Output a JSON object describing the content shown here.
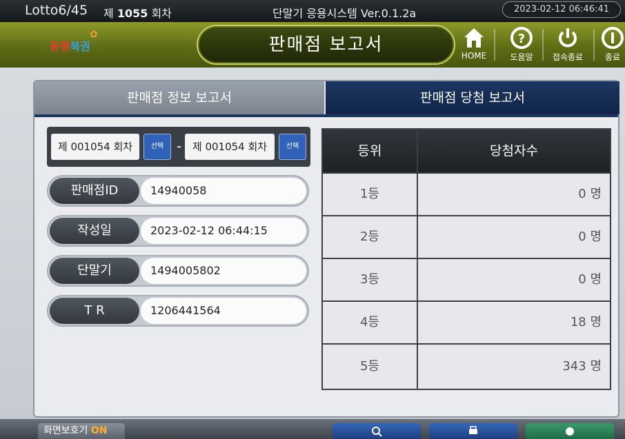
{
  "topbar": {
    "game": "Lotto6/45",
    "round_prefix": "제",
    "round_number": "1055",
    "round_suffix": "회차",
    "system": "단말기 응용시스템  Ver.0.1.2a",
    "datetime": "2023-02-12  06:46:41"
  },
  "header": {
    "logo_part1": "동행",
    "logo_part2": "복권",
    "title": "판매점 보고서",
    "buttons": {
      "home": "HOME",
      "help": "도움말",
      "logout": "접속종료",
      "exit": "종료"
    }
  },
  "tabs": {
    "info": "판매점 정보 보고서",
    "win": "판매점 당첨 보고서"
  },
  "round_range": {
    "from": "제 001054 회차",
    "to": "제 001054 회차",
    "select_label": "선택",
    "dash": "-"
  },
  "info_rows": [
    {
      "label": "판매점ID",
      "value": "14940058"
    },
    {
      "label": "작성일",
      "value": "2023-02-12  06:44:15"
    },
    {
      "label": "단말기",
      "value": "1494005802"
    },
    {
      "label": "T  R",
      "value": "1206441564"
    }
  ],
  "win_table": {
    "header_rank": "등위",
    "header_count": "당첨자수",
    "rows": [
      {
        "rank": "1등",
        "count": "0 명"
      },
      {
        "rank": "2등",
        "count": "0 명"
      },
      {
        "rank": "3등",
        "count": "0 명"
      },
      {
        "rank": "4등",
        "count": "18 명"
      },
      {
        "rank": "5등",
        "count": "343 명"
      }
    ]
  },
  "bottom": {
    "screen_saver_label": "화면보호기",
    "screen_saver_state": "ON"
  },
  "colors": {
    "header_olive": "#6b7a1a",
    "active_tab": "#1d3761",
    "select_button": "#2f62b8"
  }
}
